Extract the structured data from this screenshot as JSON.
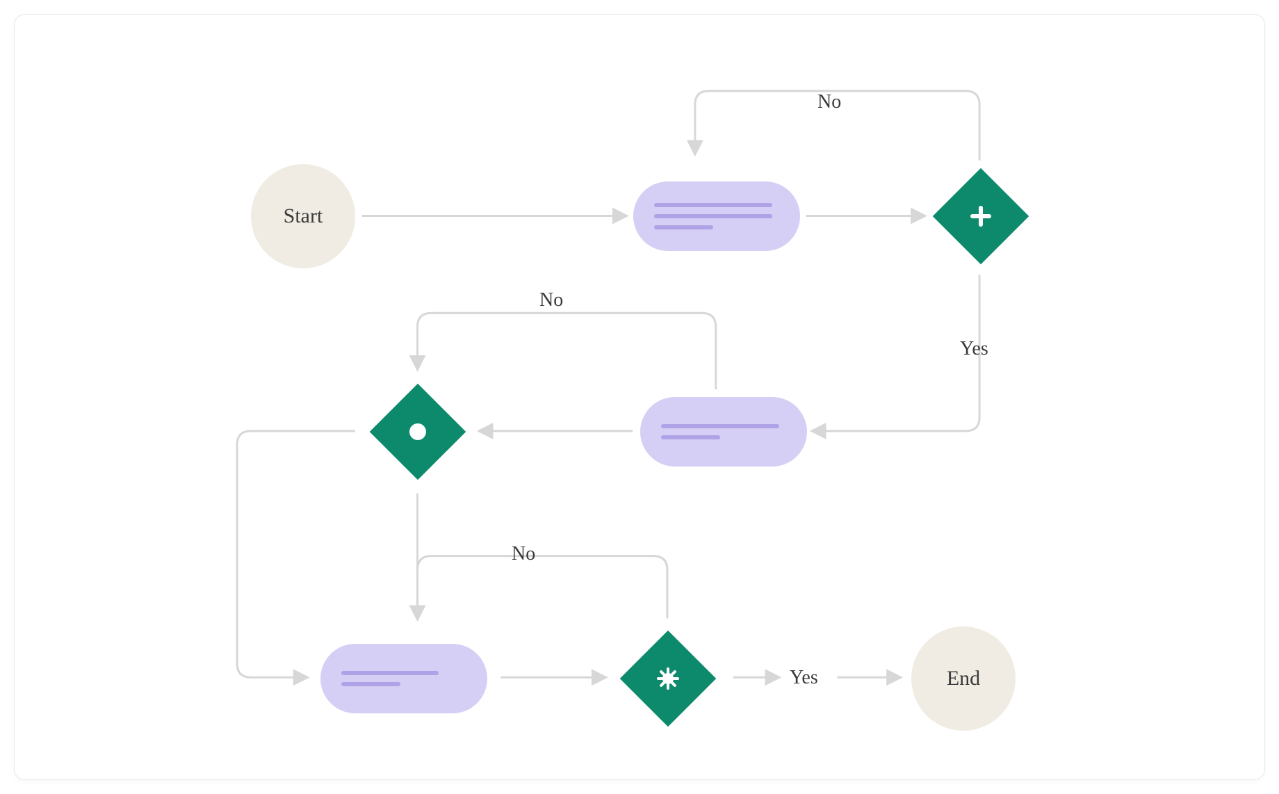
{
  "nodes": {
    "start": {
      "label": "Start"
    },
    "end": {
      "label": "End"
    },
    "process1": {
      "type": "process"
    },
    "process2": {
      "type": "process"
    },
    "process3": {
      "type": "process"
    },
    "decision1": {
      "icon": "plus"
    },
    "decision2": {
      "icon": "circle"
    },
    "decision3": {
      "icon": "burst"
    }
  },
  "edge_labels": {
    "d1_no": "No",
    "d1_yes": "Yes",
    "d2_no": "No",
    "d3_no": "No",
    "d3_yes": "Yes"
  },
  "colors": {
    "terminal_bg": "#f0ece3",
    "process_bg": "#d6cff5",
    "process_line": "#b0a2e6",
    "decision_bg": "#0d8a6b",
    "edge": "#d7d7d7",
    "text": "#3a3a3a"
  }
}
